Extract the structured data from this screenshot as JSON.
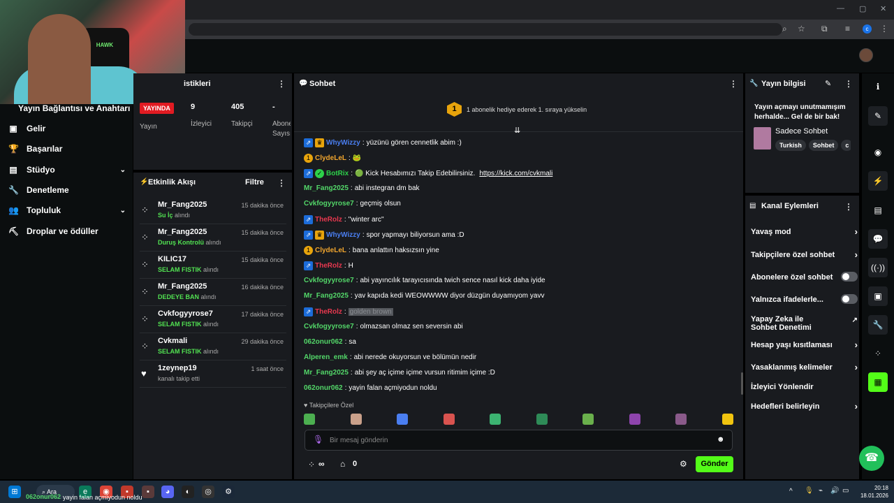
{
  "browser": {
    "window_controls": [
      "—",
      "▢",
      "✕"
    ]
  },
  "sidebar": {
    "top_label": "Yayın Bağlantısı ve Anahtarı",
    "items": [
      {
        "label": "Gelir",
        "icon": "wallet-icon"
      },
      {
        "label": "Başarılar",
        "icon": "trophy-icon"
      },
      {
        "label": "Stüdyo",
        "icon": "studio-icon",
        "expandable": true
      },
      {
        "label": "Denetleme",
        "icon": "wrench-icon"
      },
      {
        "label": "Topluluk",
        "icon": "community-icon",
        "expandable": true
      },
      {
        "label": "Droplar ve ödüller",
        "icon": "drops-icon"
      }
    ]
  },
  "stats": {
    "title_visible": "istikleri",
    "live_badge": "YAYINDA",
    "items": [
      {
        "value": "9",
        "label": "İzleyici"
      },
      {
        "value": "405",
        "label": "Takipçi"
      },
      {
        "value": "-",
        "label": "Abone Sayısı"
      }
    ],
    "left_label": "Yayın"
  },
  "activity": {
    "title": "Etkinlik Akışı",
    "filter": "Filtre",
    "items": [
      {
        "user": "Mr_Fang2025",
        "time": "15 dakika önce",
        "reward": "Su İç",
        "suffix": " alındı"
      },
      {
        "user": "Mr_Fang2025",
        "time": "15 dakika önce",
        "reward": "Duruş Kontrolü",
        "suffix": " alındı"
      },
      {
        "user": "KILIC17",
        "time": "15 dakika önce",
        "reward": "SELAM FISTIK",
        "suffix": " alındı"
      },
      {
        "user": "Mr_Fang2025",
        "time": "16 dakika önce",
        "reward": "DEDEYE BAN",
        "suffix": " alındı"
      },
      {
        "user": "Cvkfogyyrose7",
        "time": "17 dakika önce",
        "reward": "SELAM FISTIK",
        "suffix": " alındı"
      },
      {
        "user": "Cvkmali",
        "time": "29 dakika önce",
        "reward": "SELAM FISTIK",
        "suffix": " alındı"
      },
      {
        "user": "1zeynep19",
        "time": "1 saat önce",
        "reward": "",
        "suffix": "kanalı takip etti"
      }
    ]
  },
  "chat": {
    "title": "Sohbet",
    "pinned": "1 abonelik hediye ederek 1. sıraya yükselin",
    "messages": [
      {
        "user": "WhyWizzy",
        "color": "#4a7ef0",
        "badges": [
          "mod",
          "crown"
        ],
        "text": "yüzünü gören cennetlik abim :)"
      },
      {
        "user": "ClydeLeL",
        "color": "#f0a52e",
        "badges": [
          "one"
        ],
        "text": "🐸"
      },
      {
        "user": "BotRix",
        "color": "#2dd14a",
        "badges": [
          "mod",
          "bot"
        ],
        "text": "🟢 Kick Hesabımızı Takip Edebilirsiniz.",
        "link": "https://kick.com/cvkmali"
      },
      {
        "user": "Mr_Fang2025",
        "color": "#53d769",
        "badges": [],
        "text": "abi instegran dm bak"
      },
      {
        "user": "Cvkfogyyrose7",
        "color": "#53d769",
        "badges": [],
        "text": "geçmiş olsun"
      },
      {
        "user": "TheRolz",
        "color": "#e8384f",
        "badges": [
          "mod"
        ],
        "text": "''winter arc''"
      },
      {
        "user": "WhyWizzy",
        "color": "#4a7ef0",
        "badges": [
          "mod",
          "crown"
        ],
        "text": "spor yapmayı biliyorsun ama :D"
      },
      {
        "user": "ClydeLeL",
        "color": "#f0a52e",
        "badges": [
          "one"
        ],
        "text": "bana anlattın haksızsın yine"
      },
      {
        "user": "TheRolz",
        "color": "#e8384f",
        "badges": [
          "mod"
        ],
        "text": "H"
      },
      {
        "user": "Cvkfogyyrose7",
        "color": "#53d769",
        "badges": [],
        "text": "abi yayıncılık tarayıcısında twich sence nasıl kick daha iyide"
      },
      {
        "user": "Mr_Fang2025",
        "color": "#53d769",
        "badges": [],
        "text": "yav kapıda kedi WEOWWWW diyor düzgün duyamıyom yavv"
      },
      {
        "user": "TheRolz",
        "color": "#e8384f",
        "badges": [
          "mod"
        ],
        "text": "golden brown",
        "hidden": true
      },
      {
        "user": "Cvkfogyyrose7",
        "color": "#53d769",
        "badges": [],
        "text": "olmazsan olmaz sen seversin abi"
      },
      {
        "user": "062onur062",
        "color": "#53d769",
        "badges": [],
        "text": "sa"
      },
      {
        "user": "Alperen_emk",
        "color": "#53d769",
        "badges": [],
        "text": "abi nerede okuyorsun ve bölümün nedir"
      },
      {
        "user": "Mr_Fang2025",
        "color": "#53d769",
        "badges": [],
        "text": "abi şey aç içime içime vursun ritimim içime :D"
      },
      {
        "user": "062onur062",
        "color": "#53d769",
        "badges": [],
        "text": "yayin falan açmiyodun noldu"
      }
    ],
    "emote_label": "Takipçilere Özel",
    "emote_colors": [
      "#4caf50",
      "#c9a08a",
      "#4a7ef0",
      "#d9534f",
      "#3cb371",
      "#2e8b57",
      "#6ab04c",
      "#8e44ad",
      "#8a5a8a",
      "#f1c40f"
    ],
    "input_placeholder": "Bir mesaj gönderin",
    "points": "∞",
    "store_count": "0",
    "send": "Gönder"
  },
  "stream_info": {
    "title": "Yayın bilgisi",
    "stream_title": "Yayın açmayı unutmamışım herhalde... Gel de bir bak!",
    "category": "Sadece Sohbet",
    "tags": [
      "Turkish",
      "Sohbet",
      "c"
    ]
  },
  "channel_actions": {
    "title": "Kanal Eylemleri",
    "items": [
      {
        "label": "Yavaş mod",
        "control": "chevron"
      },
      {
        "label": "Takipçilere özel sohbet",
        "control": "chevron"
      },
      {
        "label": "Abonelere özel sohbet",
        "control": "toggle"
      },
      {
        "label": "Yalnızca ifadelerle...",
        "control": "toggle"
      },
      {
        "label": "Yapay Zeka ile Sohbet Denetimi",
        "control": "external"
      },
      {
        "label": "Hesap yaşı kısıtlaması",
        "control": "chevron"
      },
      {
        "label": "Yasaklanmış kelimeler",
        "control": "chevron"
      },
      {
        "label": "İzleyici Yönlendir",
        "control": "none"
      },
      {
        "label": "Hedefleri belirleyin",
        "control": "chevron"
      }
    ]
  },
  "taskbar": {
    "search": "Ara",
    "overlay_user": "062onur062",
    "overlay_text": "yayin falan açmiyodun noldu",
    "time": "20:18",
    "date": "18.01.2026"
  }
}
